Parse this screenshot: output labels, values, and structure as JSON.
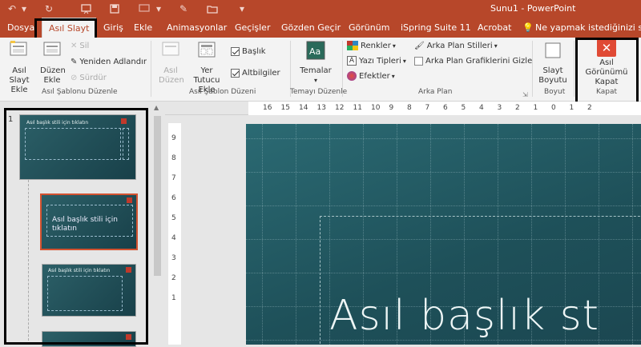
{
  "app": {
    "title": "Sunu1 - PowerPoint"
  },
  "qat": {
    "icons": [
      "undo-icon",
      "redo-icon",
      "save-icon",
      "present-icon",
      "open-icon"
    ]
  },
  "tabs": [
    {
      "label": "Dosya"
    },
    {
      "label": "Asıl Slayt"
    },
    {
      "label": "Giriş"
    },
    {
      "label": "Ekle"
    },
    {
      "label": "Animasyonlar"
    },
    {
      "label": "Geçişler"
    },
    {
      "label": "Gözden Geçir"
    },
    {
      "label": "Görünüm"
    },
    {
      "label": "iSpring Suite 11"
    },
    {
      "label": "Acrobat"
    }
  ],
  "tell_me": "Ne yapmak istediğinizi söyle",
  "ribbon": {
    "edit_master": {
      "insert_master": "Asıl Slayt Ekle",
      "insert_layout": "Düzen Ekle",
      "delete": "Sil",
      "rename": "Yeniden Adlandır",
      "preserve": "Sürdür",
      "group": "Asıl Şablonu Düzenle"
    },
    "master_layout": {
      "master_layout": "Asıl Düzen",
      "insert_placeholder": "Yer Tutucu Ekle",
      "title": "Başlık",
      "footers": "Altbilgiler",
      "group": "Asıl Şablon Düzeni"
    },
    "edit_theme": {
      "themes": "Temalar",
      "group": "Temayı Düzenle"
    },
    "background": {
      "colors": "Renkler",
      "fonts": "Yazı Tipleri",
      "effects": "Efektler",
      "bg_styles": "Arka Plan Stilleri",
      "hide_bg": "Arka Plan Grafiklerini Gizle",
      "group": "Arka Plan"
    },
    "size": {
      "slide_size": "Slayt Boyutu",
      "group": "Boyut"
    },
    "close": {
      "label": "Asıl Görünümü Kapat",
      "group": "Kapat"
    }
  },
  "slides": {
    "number": "1",
    "master_title": "Asıl başlık stili için tıklatın",
    "layout_title": "Asıl başlık stili için tıklatın"
  },
  "ruler": {
    "h": [
      "16",
      "15",
      "14",
      "13",
      "12",
      "11",
      "10",
      "9",
      "8",
      "7",
      "6",
      "5",
      "4",
      "3",
      "2",
      "1",
      "0",
      "1",
      "2"
    ],
    "v": [
      "9",
      "8",
      "7",
      "6",
      "5",
      "4",
      "3",
      "2",
      "1"
    ]
  },
  "slide": {
    "title": "Asıl başlık st"
  },
  "colors": {
    "accent": "#b7472a",
    "close_red": "#e04a35"
  }
}
